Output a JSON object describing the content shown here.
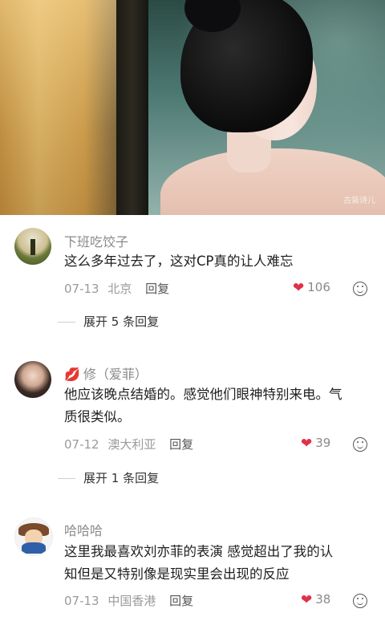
{
  "hero": {
    "watermark": "古装诗儿"
  },
  "comments": [
    {
      "username": "下班吃饺子",
      "text": "这么多年过去了，这对CP真的让人难忘",
      "date": "07-13",
      "location": "北京",
      "reply_label": "回复",
      "likes": "106",
      "expand_label": "展开 5 条回复"
    },
    {
      "username_prefix": "💋",
      "username": "修（爱菲）",
      "text_line1": "他应该晚点结婚的。感觉他们眼神特别来电。气",
      "text_line2": "质很类似。",
      "date": "07-12",
      "location": "澳大利亚",
      "reply_label": "回复",
      "likes": "39",
      "expand_label": "展开 1 条回复"
    },
    {
      "username": "哈哈哈",
      "text_line1": "这里我最喜欢刘亦菲的表演 感觉超出了我的认",
      "text_line2": "知但是又特别像是现实里会出现的反应",
      "date": "07-13",
      "location": "中国香港",
      "reply_label": "回复",
      "likes": "38"
    }
  ],
  "colors": {
    "like_heart": "#e0314a",
    "muted_text": "#9a9a9a"
  }
}
